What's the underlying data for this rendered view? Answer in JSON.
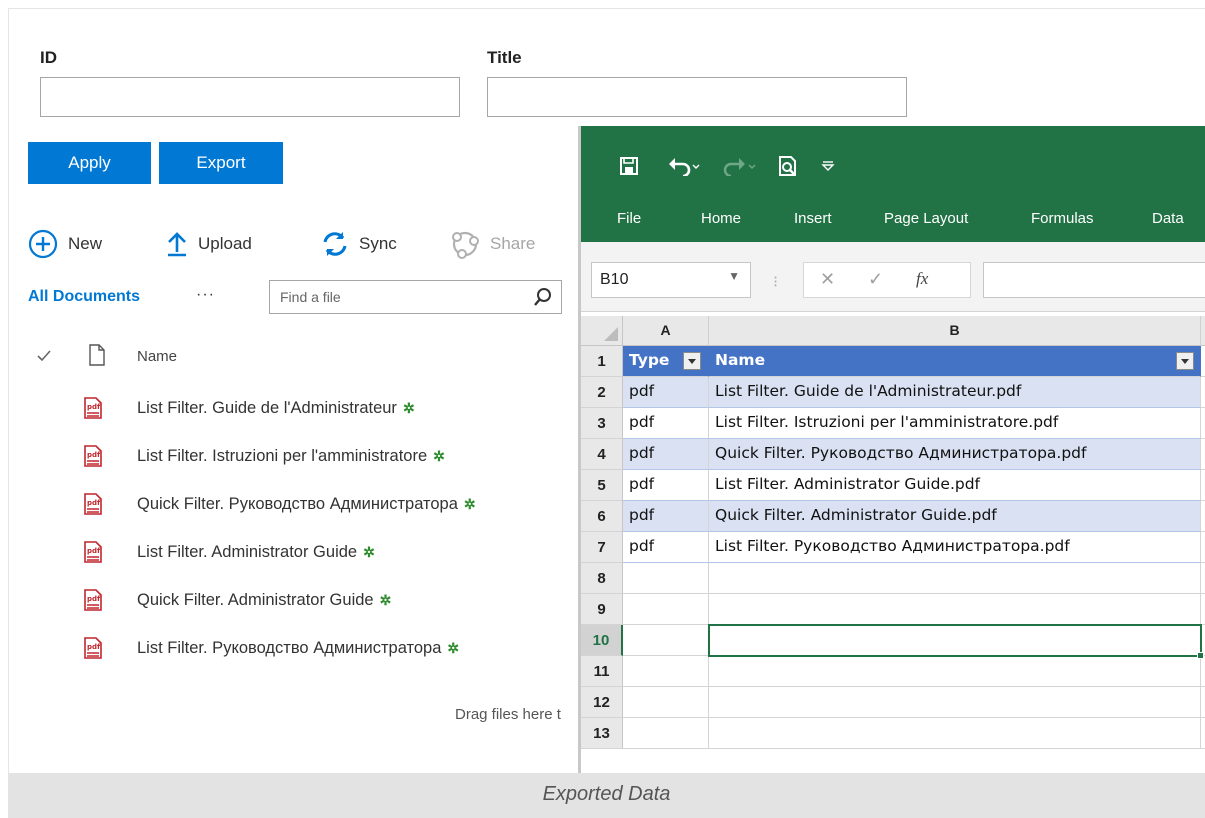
{
  "filter": {
    "id_label": "ID",
    "title_label": "Title",
    "id_value": "",
    "title_value": "",
    "apply_label": "Apply",
    "export_label": "Export"
  },
  "command_bar": {
    "new_label": "New",
    "upload_label": "Upload",
    "sync_label": "Sync",
    "share_label": "Share"
  },
  "view": {
    "name": "All Documents",
    "more": "···",
    "find_placeholder": "Find a file"
  },
  "list": {
    "name_header": "Name",
    "items": [
      {
        "name": "List Filter. Guide de l'Administrateur"
      },
      {
        "name": "List Filter. Istruzioni per l'amministratore"
      },
      {
        "name": "Quick Filter. Руководство Администратора"
      },
      {
        "name": "List Filter. Administrator Guide"
      },
      {
        "name": "Quick Filter. Administrator Guide"
      },
      {
        "name": "List Filter. Руководство Администратора"
      }
    ],
    "new_mark": "✲",
    "drag_hint": "Drag files here t"
  },
  "excel": {
    "tabs": [
      "File",
      "Home",
      "Insert",
      "Page Layout",
      "Formulas",
      "Data"
    ],
    "namebox": "B10",
    "fx": "fx",
    "columns": [
      "A",
      "B"
    ],
    "header_row": {
      "type": "Type",
      "name": "Name"
    },
    "rows": [
      {
        "n": "2",
        "type": "pdf",
        "name": "List Filter. Guide de l'Administrateur.pdf"
      },
      {
        "n": "3",
        "type": "pdf",
        "name": "List Filter. Istruzioni per l'amministratore.pdf"
      },
      {
        "n": "4",
        "type": "pdf",
        "name": "Quick Filter. Руководство Администратора.pdf"
      },
      {
        "n": "5",
        "type": "pdf",
        "name": "List Filter. Administrator Guide.pdf"
      },
      {
        "n": "6",
        "type": "pdf",
        "name": "Quick Filter. Administrator Guide.pdf"
      },
      {
        "n": "7",
        "type": "pdf",
        "name": "List Filter. Руководство Администратора.pdf"
      }
    ],
    "row_numbers": [
      "1",
      "2",
      "3",
      "4",
      "5",
      "6",
      "7",
      "8",
      "9",
      "10",
      "11",
      "12",
      "13"
    ],
    "colors": {
      "ribbon": "#217346",
      "table_header": "#4472c4",
      "band": "#d9e1f2"
    }
  },
  "caption": "Exported Data"
}
